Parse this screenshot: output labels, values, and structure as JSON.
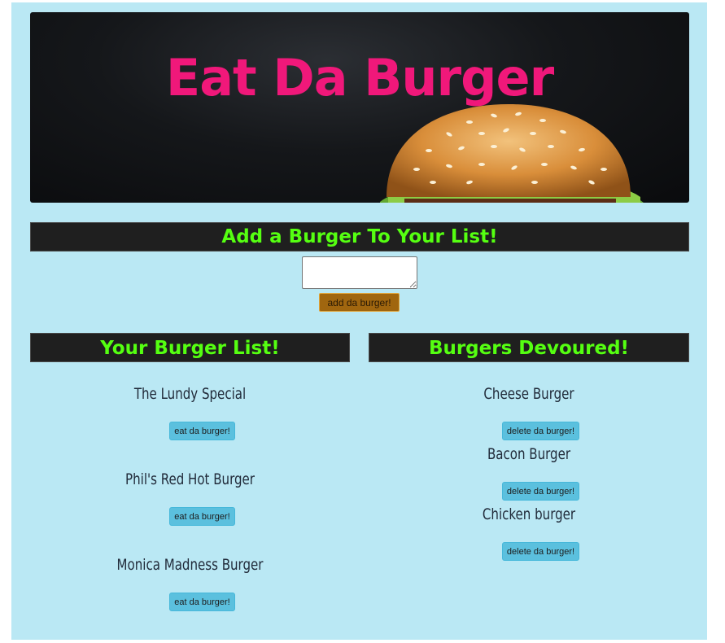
{
  "hero": {
    "title": "Eat Da Burger"
  },
  "add_section": {
    "heading": "Add a Burger To Your List!",
    "input_value": "",
    "button_label": "add da burger!"
  },
  "burger_list": {
    "heading": "Your Burger List!",
    "items": [
      {
        "name": "The Lundy Special",
        "button_label": "eat da burger!"
      },
      {
        "name": "Phil's Red Hot Burger",
        "button_label": "eat da burger!"
      },
      {
        "name": "Monica Madness Burger",
        "button_label": "eat da burger!"
      }
    ]
  },
  "devoured": {
    "heading": "Burgers Devoured!",
    "items": [
      {
        "name": "Cheese Burger",
        "button_label": "delete da burger!"
      },
      {
        "name": "Bacon Burger",
        "button_label": "delete da burger!"
      },
      {
        "name": "Chicken burger",
        "button_label": "delete da burger!"
      }
    ]
  },
  "colors": {
    "page_background": "#bae8f4",
    "title": "#f0187a",
    "heading_text": "#55ff11",
    "heading_background": "#1f1f1f",
    "add_button": "#a0660f",
    "action_button": "#5bc0de"
  }
}
